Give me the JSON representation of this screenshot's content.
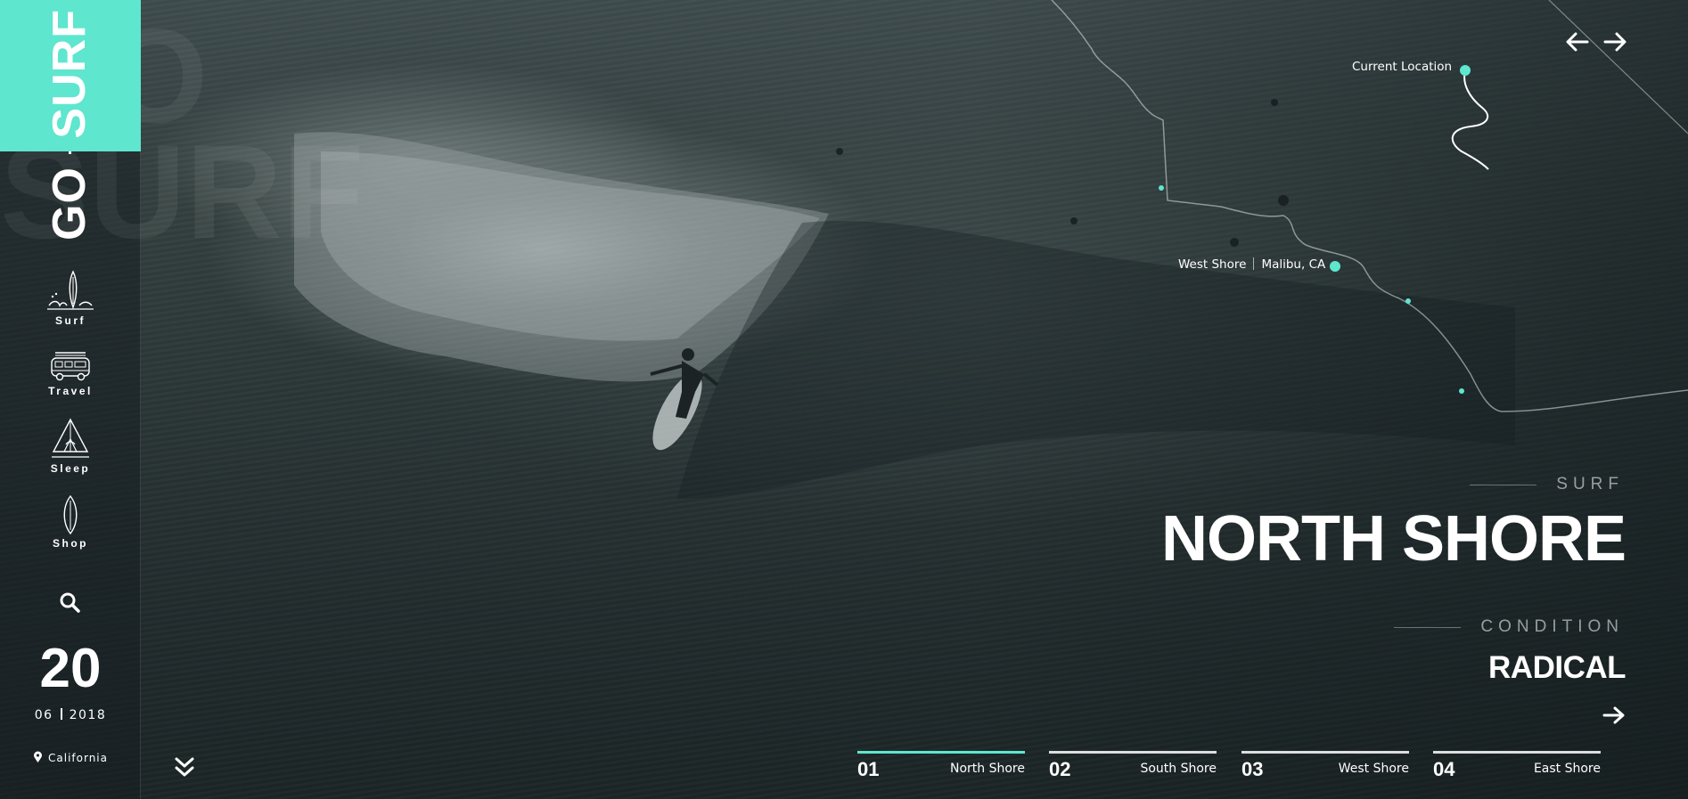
{
  "brand": {
    "logo_go": "GO",
    "logo_surf": "SURF",
    "accent_color": "#5ee6cf"
  },
  "sidebar": {
    "items": [
      {
        "label": "Surf",
        "icon": "surfboard-waves-icon"
      },
      {
        "label": "Travel",
        "icon": "van-icon"
      },
      {
        "label": "Sleep",
        "icon": "tent-icon"
      },
      {
        "label": "Shop",
        "icon": "surfboard-icon"
      }
    ],
    "search_icon": "search-icon",
    "date_day": "20",
    "date_month": "06",
    "date_year": "2018",
    "location": "California"
  },
  "map": {
    "current_location_label": "Current Location",
    "pin_spot": "West Shore",
    "pin_place": "Malibu, CA"
  },
  "spot": {
    "eyebrow": "SURF",
    "title": "NORTH SHORE",
    "condition_label": "CONDITION",
    "condition_value": "RADICAL"
  },
  "tabs": [
    {
      "num": "01",
      "name": "North Shore",
      "active": true
    },
    {
      "num": "02",
      "name": "South Shore",
      "active": false
    },
    {
      "num": "03",
      "name": "West Shore",
      "active": false
    },
    {
      "num": "04",
      "name": "East Shore",
      "active": false
    }
  ]
}
